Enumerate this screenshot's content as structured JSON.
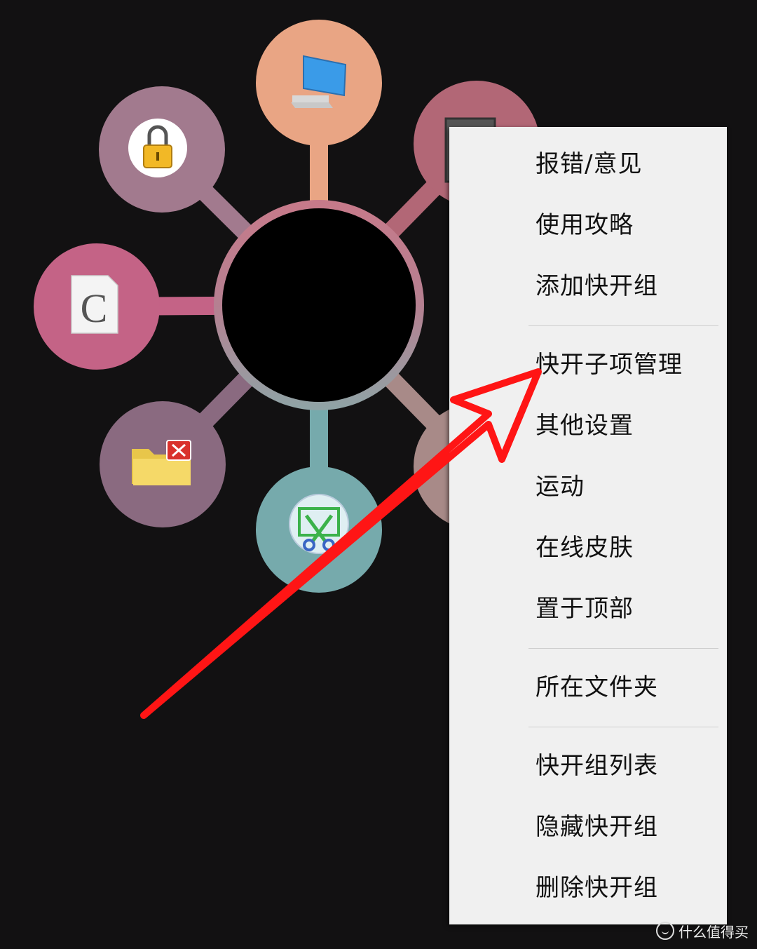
{
  "widget": {
    "hub_color": "#000000",
    "bubbles": [
      {
        "name": "computer",
        "icon": "computer-icon",
        "color": "#e9a584",
        "letter": ""
      },
      {
        "name": "lock",
        "icon": "lock-icon",
        "color": "#a27a8e",
        "letter": ""
      },
      {
        "name": "unknown-app",
        "icon": "app-window-icon",
        "color": "#b26776",
        "letter": ""
      },
      {
        "name": "c-document",
        "icon": "c-document-icon",
        "color": "#c46386",
        "letter": "C"
      },
      {
        "name": "folder",
        "icon": "folder-close-icon",
        "color": "#8a6a80",
        "letter": ""
      },
      {
        "name": "screenshot-tool",
        "icon": "scissors-icon",
        "color": "#76aaac",
        "letter": ""
      },
      {
        "name": "partial-bubble",
        "icon": "",
        "color": "#a88a88",
        "letter": ""
      }
    ]
  },
  "context_menu": {
    "groups": [
      [
        "报错/意见",
        "使用攻略",
        "添加快开组"
      ],
      [
        "快开子项管理",
        "其他设置",
        "运动",
        "在线皮肤",
        "置于顶部"
      ],
      [
        "所在文件夹"
      ],
      [
        "快开组列表",
        "隐藏快开组",
        "删除快开组"
      ]
    ]
  },
  "annotation": {
    "arrow_color": "#ff1515"
  },
  "watermark": {
    "icon": "smile-icon",
    "text": "什么值得买"
  }
}
